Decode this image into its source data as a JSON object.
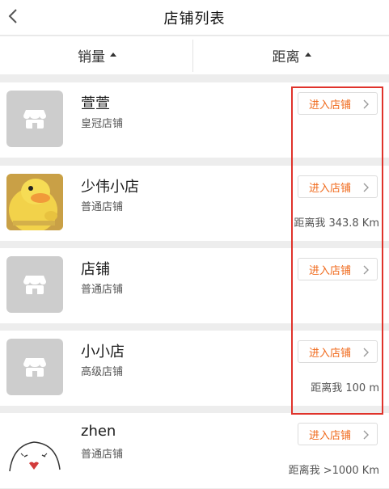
{
  "nav": {
    "title": "店铺列表"
  },
  "sort": {
    "sales_label": "销量",
    "distance_label": "距离"
  },
  "shops": [
    {
      "name": "萱萱",
      "level": "皇冠店铺",
      "enter_label": "进入店铺",
      "distance": "",
      "avatar": "store-placeholder-icon"
    },
    {
      "name": "少伟小店",
      "level": "普通店铺",
      "enter_label": "进入店铺",
      "distance": "距离我 343.8 Km",
      "avatar": "yellow-duck-photo"
    },
    {
      "name": "店铺",
      "level": "普通店铺",
      "enter_label": "进入店铺",
      "distance": "",
      "avatar": "store-placeholder-icon"
    },
    {
      "name": "小小店",
      "level": "高级店铺",
      "enter_label": "进入店铺",
      "distance": "距离我 100 m",
      "avatar": "store-placeholder-icon"
    },
    {
      "name": "zhen",
      "level": "普通店铺",
      "enter_label": "进入店铺",
      "distance": "距离我 >1000 Km",
      "avatar": "cartoon-sketch"
    }
  ],
  "colors": {
    "accent": "#f06a1c",
    "highlight": "#e0332b",
    "background": "#ededed"
  }
}
